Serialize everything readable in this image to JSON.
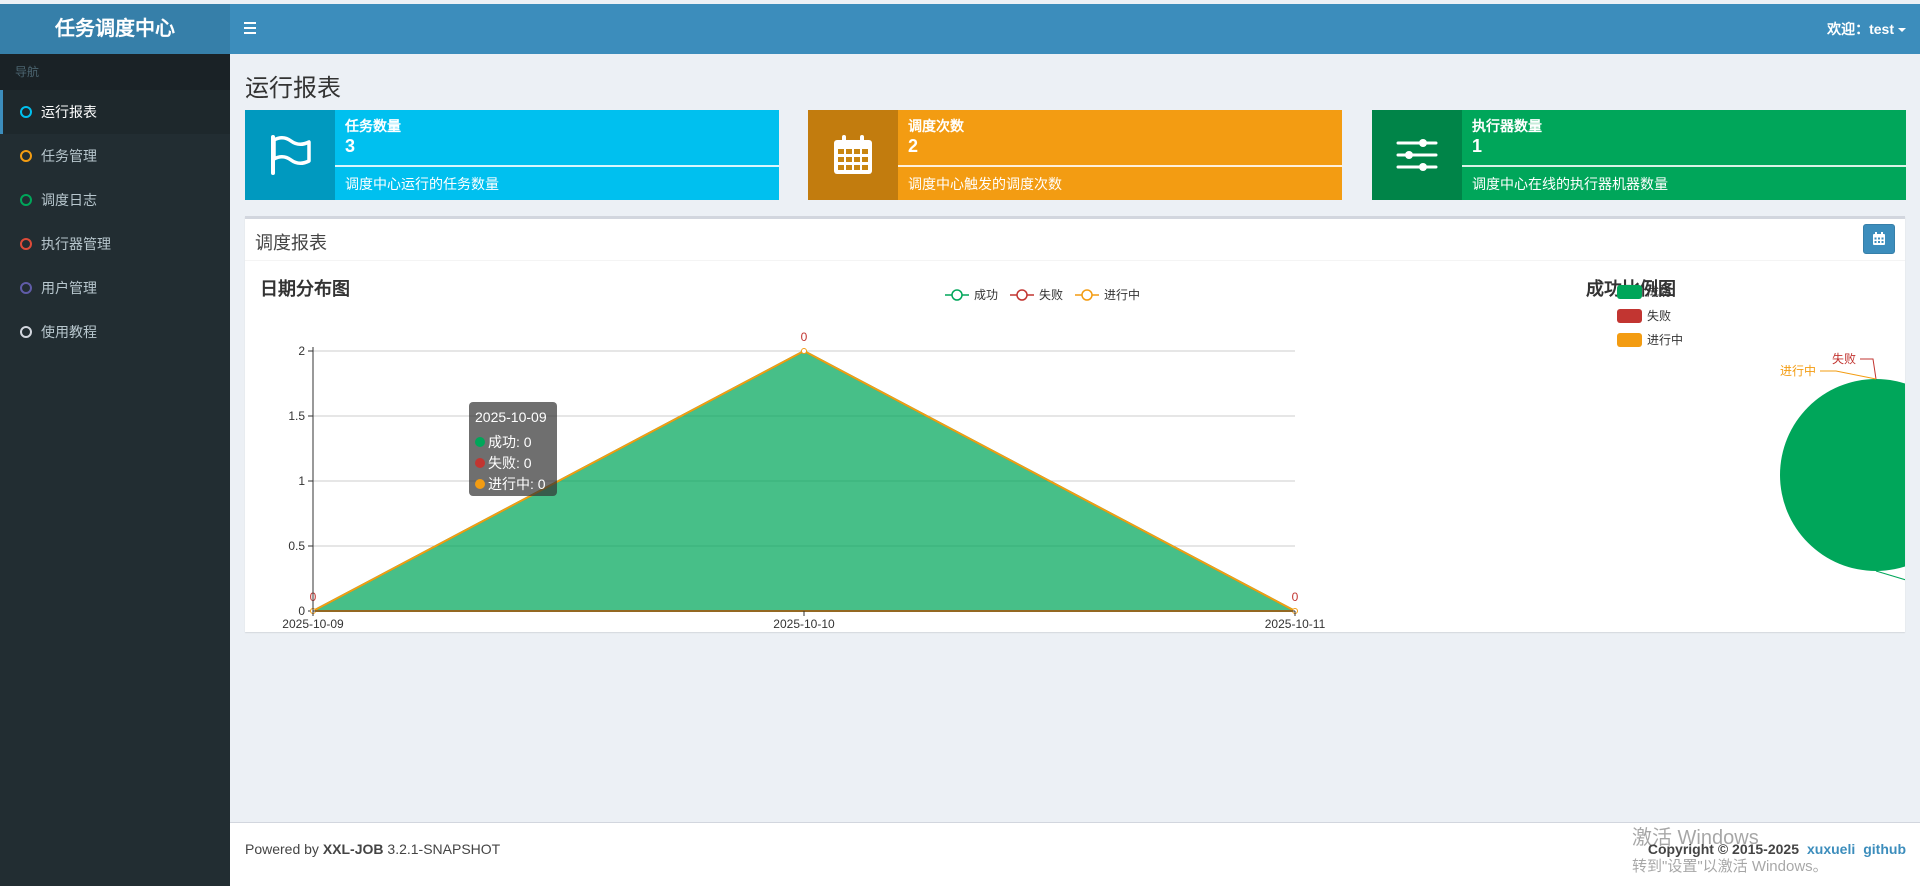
{
  "header": {
    "logo": "任务调度中心",
    "user": "欢迎：test"
  },
  "sidebar": {
    "section": "导航",
    "items": [
      {
        "label": "运行报表",
        "color": "#00c0ef",
        "active": true
      },
      {
        "label": "任务管理",
        "color": "#f39c12"
      },
      {
        "label": "调度日志",
        "color": "#00a65a"
      },
      {
        "label": "执行器管理",
        "color": "#dd4b39"
      },
      {
        "label": "用户管理",
        "color": "#605ca8"
      },
      {
        "label": "使用教程",
        "color": "#d2d6de"
      }
    ]
  },
  "page": {
    "title": "运行报表"
  },
  "cards": [
    {
      "label": "任务数量",
      "value": "3",
      "desc": "调度中心运行的任务数量",
      "icon": "flag-icon",
      "color": "#00c0ef"
    },
    {
      "label": "调度次数",
      "value": "2",
      "desc": "调度中心触发的调度次数",
      "icon": "calendar-icon",
      "color": "#f39c12"
    },
    {
      "label": "执行器数量",
      "value": "1",
      "desc": "调度中心在线的执行器机器数量",
      "icon": "sliders-icon",
      "color": "#00a65a"
    }
  ],
  "report": {
    "title": "调度报表"
  },
  "chart_data": [
    {
      "type": "area",
      "title": "日期分布图",
      "x": [
        "2025-10-09",
        "2025-10-10",
        "2025-10-11"
      ],
      "ylim": [
        0,
        2
      ],
      "yticks": [
        "0",
        "0.5",
        "1",
        "1.5",
        "2"
      ],
      "series": [
        {
          "name": "成功",
          "values": [
            0,
            2,
            0
          ],
          "color": "#00a65a"
        },
        {
          "name": "失败",
          "values": [
            0,
            0,
            0
          ],
          "color": "#c23531"
        },
        {
          "name": "进行中",
          "values": [
            0,
            0,
            0
          ],
          "color": "#f39c12"
        }
      ],
      "point_labels": [
        "0",
        "0",
        "0"
      ],
      "legend": "top-center",
      "grid": true,
      "tooltip": {
        "title": "2025-10-09",
        "rows": [
          "成功: 0",
          "失败: 0",
          "进行中: 0"
        ]
      }
    },
    {
      "type": "pie",
      "title": "成功比例图",
      "labels": [
        "成功",
        "失败",
        "进行中"
      ],
      "values": [
        2,
        0,
        0
      ],
      "colors": [
        "#00a65a",
        "#c23531",
        "#f39c12"
      ],
      "legend": "top-left"
    }
  ],
  "footer": {
    "powered_prefix": "Powered by ",
    "brand": "XXL-JOB",
    "version": " 3.2.1-SNAPSHOT",
    "copyright": "Copyright © 2015-2025",
    "link1": "xuxueli",
    "link2": "github"
  },
  "watermark": {
    "line1": "激活 Windows",
    "line2": "转到\"设置\"以激活 Windows。"
  }
}
